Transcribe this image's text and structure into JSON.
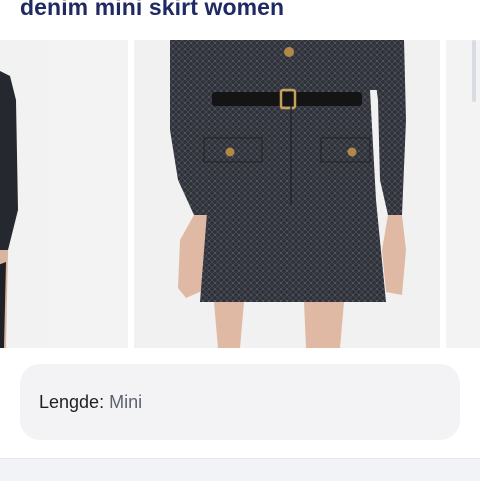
{
  "search": {
    "query": "denim mini skirt women"
  },
  "carousel": {
    "images": [
      {
        "icon": "product-image-partial-outfit"
      },
      {
        "icon": "product-image-tweed-mini-skirt"
      },
      {
        "icon": "product-image-partial"
      }
    ]
  },
  "attribute": {
    "label": "Lengde:",
    "value": "Mini"
  },
  "colors": {
    "title": "#1f2a63",
    "fabric": "#2f3138",
    "infoBackground": "#f3f3f5"
  }
}
